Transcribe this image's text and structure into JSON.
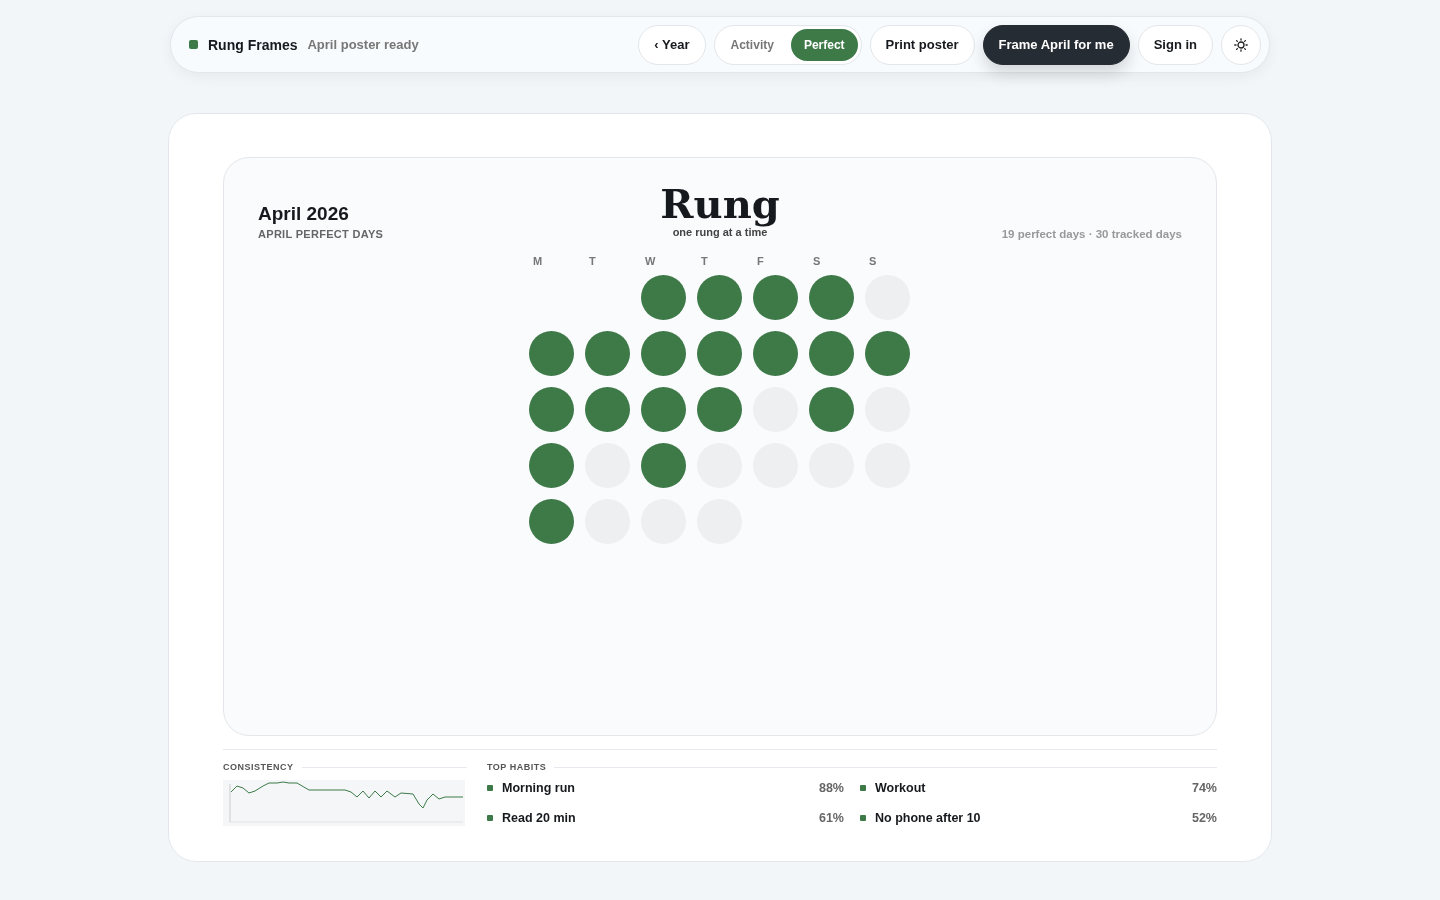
{
  "brand": {
    "name": "Rung Frames",
    "status": "April poster ready"
  },
  "nav": {
    "back": "‹ Year",
    "modes": [
      {
        "label": "Activity",
        "selected": false
      },
      {
        "label": "Perfect",
        "selected": true
      }
    ],
    "print": "Print poster",
    "cta": "Frame April for me",
    "signin": "Sign in"
  },
  "poster": {
    "month": "April 2026",
    "subtitle": "APRIL PERFECT DAYS",
    "logo": "Rung",
    "tagline": "one rung at a time",
    "summary": "19 perfect days · 30 tracked days",
    "weekdays": [
      "M",
      "T",
      "W",
      "T",
      "F",
      "S",
      "S"
    ],
    "weeks": [
      [
        {
          "kind": "blank"
        },
        {
          "kind": "blank"
        },
        {
          "perfect": true
        },
        {
          "perfect": true
        },
        {
          "perfect": true
        },
        {
          "perfect": true
        },
        {
          "perfect": false
        }
      ],
      [
        {
          "perfect": true
        },
        {
          "perfect": true
        },
        {
          "perfect": true
        },
        {
          "perfect": true
        },
        {
          "perfect": true
        },
        {
          "perfect": true
        },
        {
          "perfect": true
        }
      ],
      [
        {
          "perfect": true
        },
        {
          "perfect": true
        },
        {
          "perfect": true
        },
        {
          "perfect": true
        },
        {
          "perfect": false
        },
        {
          "perfect": true
        },
        {
          "perfect": false
        }
      ],
      [
        {
          "perfect": true
        },
        {
          "perfect": false
        },
        {
          "perfect": true
        },
        {
          "perfect": false
        },
        {
          "perfect": false
        },
        {
          "perfect": false
        },
        {
          "perfect": false
        }
      ],
      [
        {
          "perfect": true
        },
        {
          "perfect": false
        },
        {
          "perfect": false
        },
        {
          "perfect": false
        }
      ]
    ]
  },
  "consistency": {
    "title": "CONSISTENCY"
  },
  "habits": {
    "title": "TOP HABITS",
    "items": [
      {
        "name": "Morning run",
        "pct": "88%"
      },
      {
        "name": "Workout",
        "pct": "74%"
      },
      {
        "name": "Read 20 min",
        "pct": "61%"
      },
      {
        "name": "No phone after 10",
        "pct": "52%"
      }
    ]
  }
}
